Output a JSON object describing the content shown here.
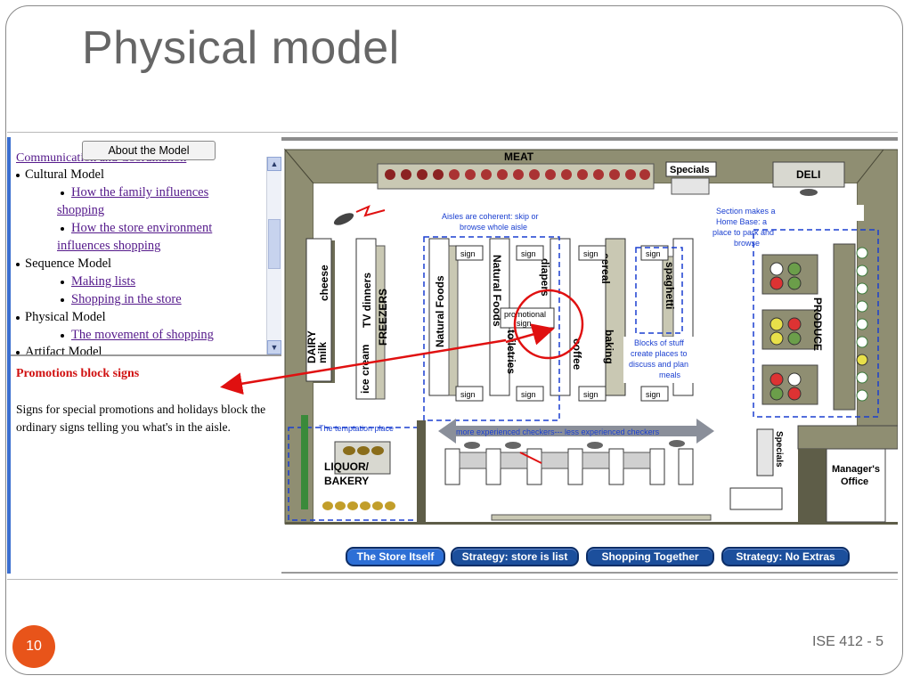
{
  "slide": {
    "title": "Physical model",
    "page_number": "10",
    "footer": "ISE 412 - 5",
    "accent_color": "#e8541a"
  },
  "nav": {
    "about_button": "About the Model",
    "partial_top": "Communication and Coordination",
    "items": [
      {
        "label": "Cultural Model",
        "subitems": [
          "How the family influences",
          "shopping",
          "How the store environment",
          "influences shopping"
        ]
      },
      {
        "label": "Sequence Model",
        "subitems": [
          "Making lists",
          "Shopping in the store"
        ]
      },
      {
        "label": "Physical Model",
        "subitems": [
          "The movement of shopping"
        ]
      },
      {
        "label": "Artifact Model",
        "subitems": []
      }
    ]
  },
  "description": {
    "title": "Promotions block signs",
    "body": "Signs for special promotions and holidays block the ordinary signs telling you what's in the aisle."
  },
  "map": {
    "labels": {
      "meat": "MEAT",
      "specials_top": "Specials",
      "deli": "DELI",
      "aisle_note": [
        "Aisles are coherent: skip or",
        "browse whole aisle"
      ],
      "homebase_note": [
        "Section makes a",
        "Home Base: a",
        "place to park and",
        "browse"
      ],
      "blocks_note": [
        "Blocks of stuff",
        "create places to",
        "discuss and plan",
        "meals"
      ],
      "promo_sign": [
        "promotional",
        "sign"
      ],
      "sign": "sign",
      "dairy": [
        "DAIRY",
        "milk"
      ],
      "cheese": "cheese",
      "tv_dinners": "TV dinners",
      "freezers": "FREEZERS",
      "ice_cream": "ice cream",
      "natural_foods": "Natural Foods",
      "toiletries": "toiletries",
      "diapers": "diapers",
      "coffee": "coffee",
      "cereal": "cereal",
      "baking": "baking",
      "spaghetti": "spaghetti",
      "produce": "PRODUCE",
      "temptation": "The temptation place",
      "checkers": "more experienced checkers--- less experienced checkers",
      "liquor": "LIQUOR/",
      "bakery": "BAKERY",
      "specials_side": "Specials",
      "manager": [
        "Manager's",
        "Office"
      ]
    },
    "strategies": [
      "The Store Itself",
      "Strategy: store is list",
      "Shopping Together",
      "Strategy: No Extras"
    ],
    "colors": {
      "floor": "#ffffff",
      "walls": "#8f8e72",
      "wall_dark": "#5e5d48",
      "annotation_blue": "#1a3fd0",
      "highlight_red": "#e01010",
      "button_blue": "#1c4f9c"
    }
  }
}
